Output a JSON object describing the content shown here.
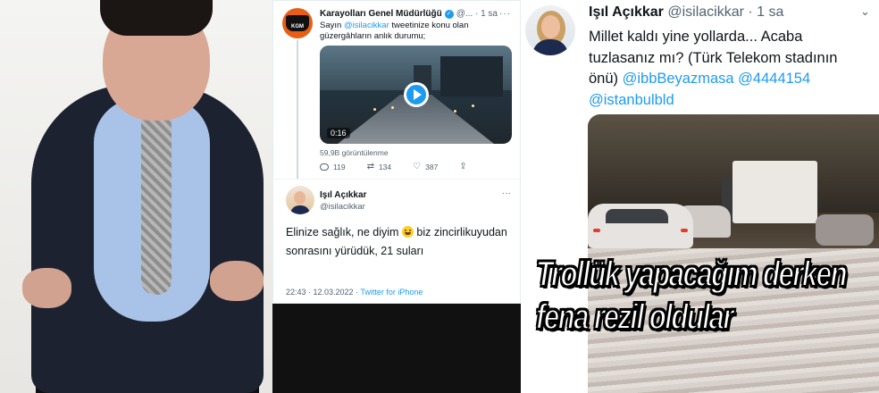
{
  "left_photo": {
    "alt_subject": "seated-man-in-suit"
  },
  "tweet_kgm": {
    "author_name": "Karayolları Genel Müdürlüğü",
    "meta": "@... · 1 sa",
    "text_prefix": "Sayın ",
    "mention": "@isilacikkar",
    "text_rest": " tweetinize konu olan güzergâhların anlık durumu;",
    "video_duration": "0:16",
    "views": "59,9B görüntülenme",
    "counts": {
      "replies": "119",
      "retweets": "134",
      "likes": "387"
    },
    "avatar_label": "KGM"
  },
  "tweet_isil_reply": {
    "author_name": "Işıl Açıkkar",
    "handle": "@isilacikkar",
    "text_a": "Elinize sağlık, ne diyim ",
    "text_b": " biz zincirlikuyudan sonrasını yürüdük, 21 suları",
    "timestamp": "22:43 · 12.03.2022 · ",
    "source": "Twitter for iPhone"
  },
  "tweet_isil_main": {
    "author_name": "Işıl Açıkkar",
    "meta": "@isilacikkar · 1 sa",
    "text": "Millet kaldı yine yollarda... Acaba tuzlasanız mı? (Türk Telekom stadının önü) ",
    "links": "@ibbBeyazmasa @4444154 @istanbulbld"
  },
  "caption": {
    "line1": "Trollük yapacağım derken",
    "line2": "fena rezil oldular"
  },
  "colors": {
    "link": "#1d9bf0",
    "kgm_orange": "#e85e14",
    "text": "#0f1419",
    "muted": "#536471"
  }
}
